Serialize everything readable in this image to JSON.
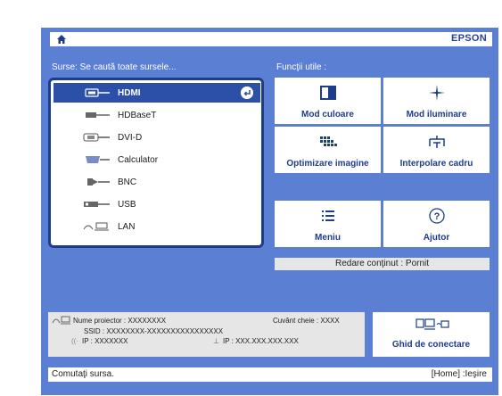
{
  "header": {
    "brand": "EPSON"
  },
  "sources": {
    "heading": "Surse: Se caută toate sursele...",
    "items": [
      {
        "label": "HDMI",
        "icon": "hdmi-icon",
        "selected": true
      },
      {
        "label": "HDBaseT",
        "icon": "hdbaset-icon"
      },
      {
        "label": "DVI-D",
        "icon": "dvi-icon"
      },
      {
        "label": "Calculator",
        "icon": "computer-vga-icon"
      },
      {
        "label": "BNC",
        "icon": "bnc-icon"
      },
      {
        "label": "USB",
        "icon": "usb-icon"
      },
      {
        "label": "LAN",
        "icon": "lan-icon"
      }
    ]
  },
  "functions": {
    "heading": "Funcţii utile :",
    "buttons": [
      {
        "label": "Mod culoare",
        "icon": "color-mode-icon"
      },
      {
        "label": "Mod iluminare",
        "icon": "light-mode-icon"
      },
      {
        "label": "Optimizare imagine",
        "icon": "image-optimize-icon"
      },
      {
        "label": "Interpolare cadru",
        "icon": "frame-interpolation-icon"
      },
      {
        "label": "Meniu",
        "icon": "menu-icon"
      },
      {
        "label": "Ajutor",
        "icon": "help-icon"
      }
    ],
    "content_playback": "Redare conţinut : Pornit"
  },
  "network": {
    "projector_name": "Nume proiector :  XXXXXXXX",
    "ssid": "SSID :  XXXXXXXX-XXXXXXXXXXXXXXXX",
    "ip_wireless": "IP :  XXXXXXX",
    "ip_wired": "IP :   XXX.XXX.XXX.XXX",
    "keyword": "Cuvânt cheie :  XXXX"
  },
  "guide_button": {
    "label": "Ghid de conectare"
  },
  "footer": {
    "left": "Comutaţi sursa.",
    "right": "[Home] :Ieşire"
  },
  "colors": {
    "panel": "#5a7fd3",
    "accent": "#1e3c8c",
    "selected": "#2c50a8"
  }
}
